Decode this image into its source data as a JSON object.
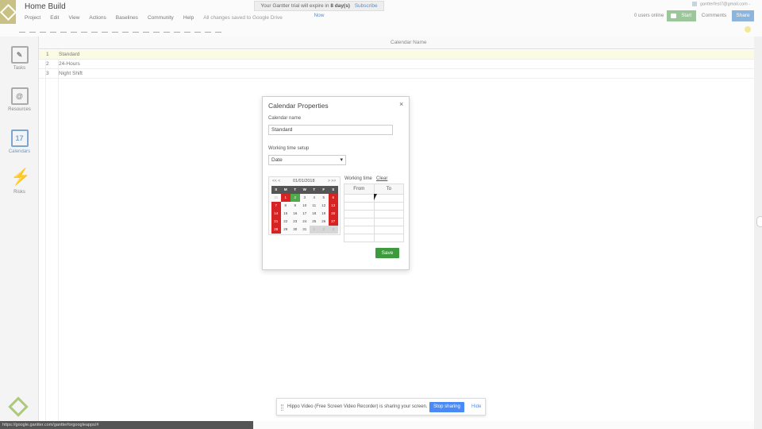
{
  "app": {
    "title": "Home Build",
    "menu": [
      "Project",
      "Edit",
      "View",
      "Actions",
      "Baselines",
      "Community",
      "Help"
    ],
    "saved_status": "All changes saved to Google Drive",
    "trial_text": "Your Gantter trial will expire in ",
    "trial_days": "8 day(s)",
    "subscribe": "Subscribe Now",
    "user_email": "gantterfest7@gmail.com -",
    "users_online": "0 users online",
    "start_label": "Start",
    "comments_label": "Comments",
    "share_label": "Share"
  },
  "nav": {
    "tasks": "Tasks",
    "resources": "Resources",
    "calendars": "Calendars",
    "calendars_day": "17",
    "risks": "Risks"
  },
  "grid": {
    "header": "Calendar Name",
    "rows": [
      {
        "num": "1",
        "name": "Standard"
      },
      {
        "num": "2",
        "name": "24-Hours"
      },
      {
        "num": "3",
        "name": "Night Shift"
      }
    ]
  },
  "dialog": {
    "title": "Calendar Properties",
    "close": "×",
    "name_label": "Calendar name",
    "name_value": "Standard",
    "setup_label": "Working time setup",
    "setup_value": "Date",
    "calendar": {
      "prev": "<< <",
      "next": "> >>",
      "month": "01/01/2018",
      "days": [
        "S",
        "M",
        "T",
        "W",
        "T",
        "F",
        "S"
      ],
      "weeks": [
        [
          "31",
          "1",
          "2",
          "3",
          "4",
          "5",
          "6"
        ],
        [
          "7",
          "8",
          "9",
          "10",
          "11",
          "12",
          "13"
        ],
        [
          "14",
          "15",
          "16",
          "17",
          "18",
          "19",
          "20"
        ],
        [
          "21",
          "22",
          "23",
          "24",
          "25",
          "26",
          "27"
        ],
        [
          "28",
          "29",
          "30",
          "31",
          "1",
          "2",
          "3"
        ]
      ]
    },
    "working_time_label": "Working time",
    "clear_label": "Clear",
    "from_label": "From",
    "to_label": "To",
    "save_label": "Save"
  },
  "share_bar": {
    "message": "Hippo Video (Free Screen Video Recorder) is sharing your screen.",
    "stop": "Stop sharing",
    "hide": "Hide"
  },
  "status_url": "https://google.gantter.com/gantterforgoogleapps/#"
}
